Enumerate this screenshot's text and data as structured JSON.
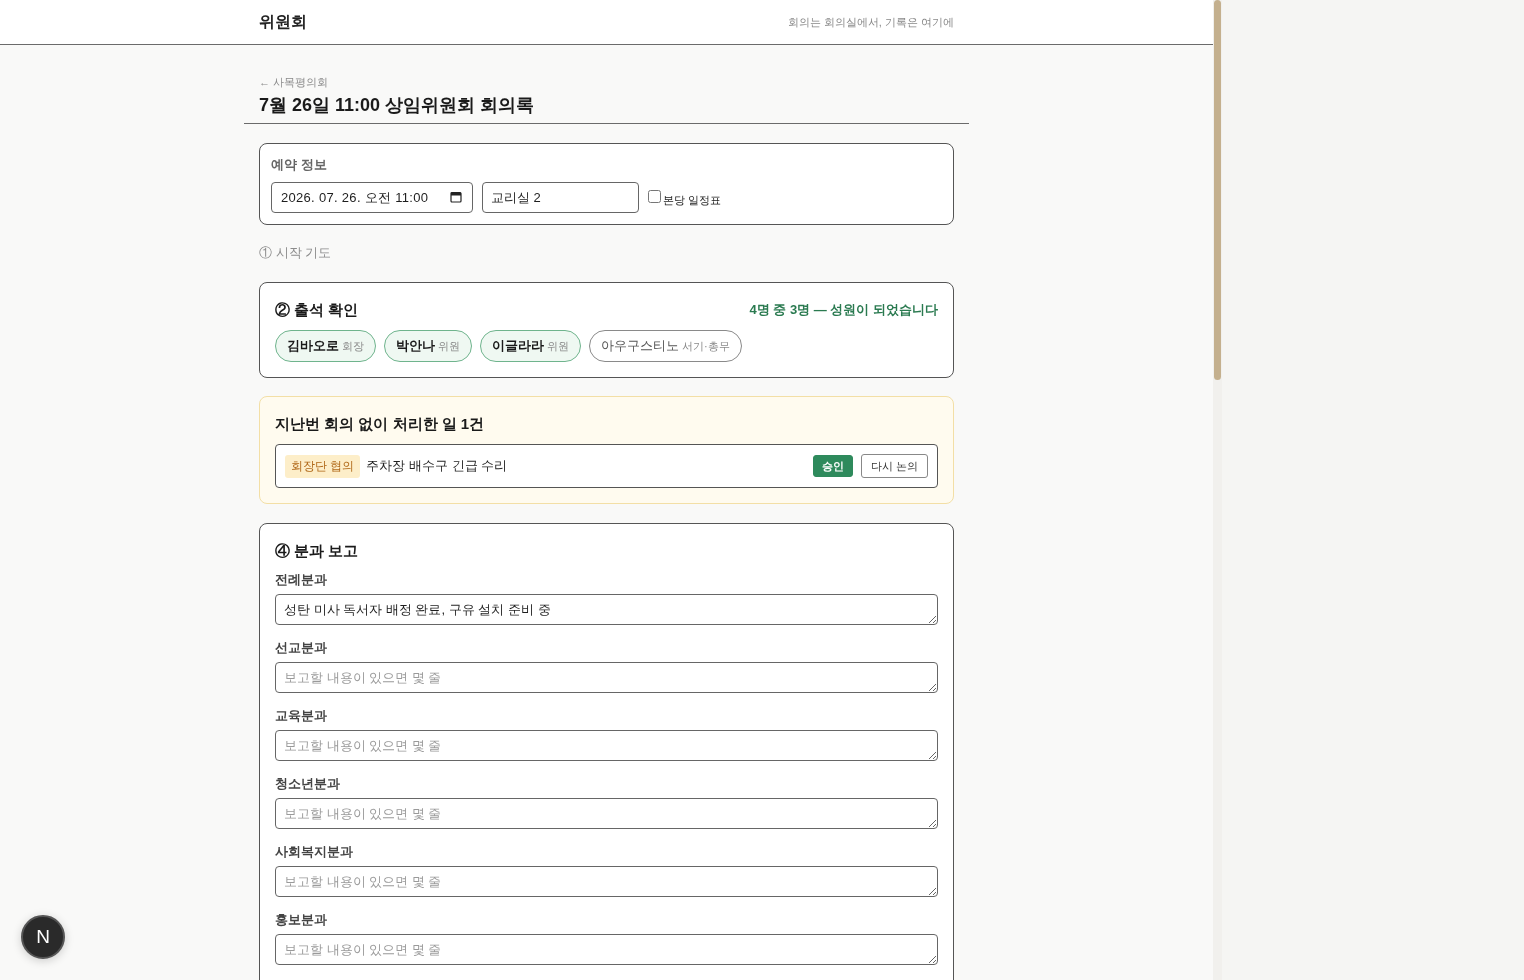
{
  "header": {
    "brand": "위원회",
    "tagline": "회의는 회의실에서, 기록은 여기에"
  },
  "page": {
    "back_link": "← 사목평의회",
    "title": "7월 26일 11:00 상임위원회 회의록"
  },
  "reservation": {
    "heading": "예약 정보",
    "datetime": "2026. 07. 26. 오전 11:00",
    "room": "교리실 2",
    "main_church_schedule": {
      "label": "본당 일정표",
      "checked": false
    }
  },
  "opening_prayer": {
    "title": "① 시작 기도"
  },
  "attendance": {
    "title": "② 출석 확인",
    "summary": "4명 중 3명 — 성원이 되었습니다",
    "members": [
      {
        "name": "김바오로",
        "role": "회장",
        "present": true
      },
      {
        "name": "박안나",
        "role": "위원",
        "present": true
      },
      {
        "name": "이글라라",
        "role": "위원",
        "present": true
      },
      {
        "name": "아우구스티노",
        "role": "서기·총무",
        "present": false
      }
    ]
  },
  "interim_decisions": {
    "title": "지난번 회의 없이 처리한 일 1건",
    "items": [
      {
        "tag": "회장단 협의",
        "text": "주차장 배수구 긴급 수리",
        "actions": [
          {
            "label": "승인",
            "selected": true
          },
          {
            "label": "다시 논의",
            "selected": false
          }
        ]
      }
    ]
  },
  "committee_reports": {
    "title": "④ 분과 보고",
    "reports": [
      {
        "label": "전례분과",
        "value": "성탄 미사 독서자 배정 완료, 구유 설치 준비 중"
      },
      {
        "label": "선교분과",
        "placeholder": "보고할 내용이 있으면 몇 줄"
      },
      {
        "label": "교육분과",
        "placeholder": "보고할 내용이 있으면 몇 줄"
      },
      {
        "label": "청소년분과",
        "placeholder": "보고할 내용이 있으면 몇 줄"
      },
      {
        "label": "사회복지분과",
        "placeholder": "보고할 내용이 있으면 몇 줄"
      },
      {
        "label": "홍보분과",
        "placeholder": "보고할 내용이 있으면 몇 줄"
      }
    ]
  },
  "dev_badge": {
    "label": "N"
  }
}
